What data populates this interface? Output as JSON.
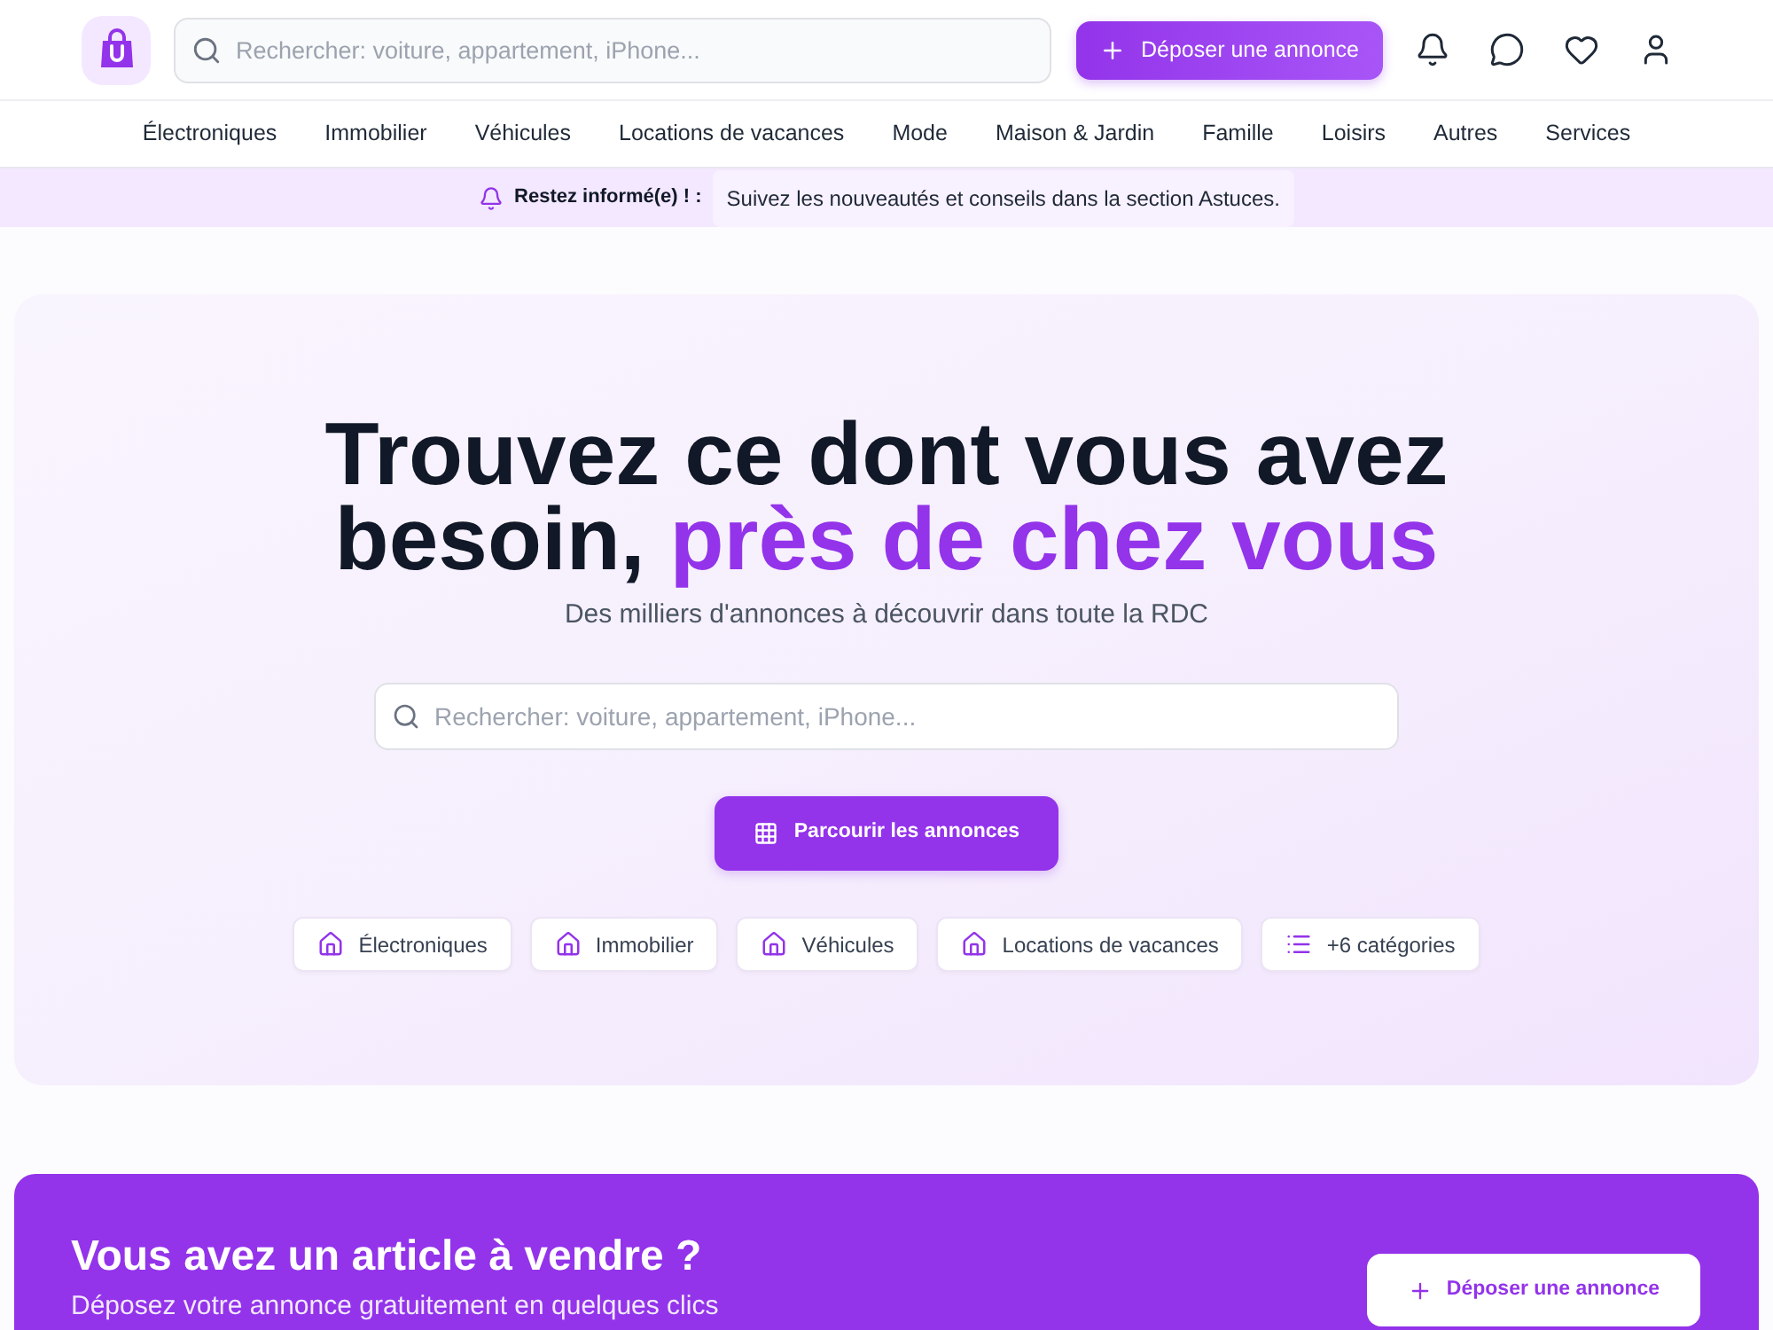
{
  "header": {
    "search": {
      "placeholder": "Rechercher: voiture, appartement, iPhone..."
    },
    "post_button": "Déposer une annonce"
  },
  "nav": [
    {
      "label": "Électroniques"
    },
    {
      "label": "Immobilier"
    },
    {
      "label": "Véhicules"
    },
    {
      "label": "Locations de vacances"
    },
    {
      "label": "Mode"
    },
    {
      "label": "Maison & Jardin"
    },
    {
      "label": "Famille"
    },
    {
      "label": "Loisirs"
    },
    {
      "label": "Autres"
    },
    {
      "label": "Services"
    }
  ],
  "info_bar": {
    "title": "Restez informé(e) ! :",
    "message": "Suivez les nouveautés et conseils dans la section Astuces."
  },
  "hero": {
    "title": "Trouvez ce dont vous avez besoin,",
    "title_highlight": "près de chez vous",
    "subtitle": "Des milliers d'annonces à découvrir dans toute la RDC",
    "search": {
      "placeholder": "Rechercher: voiture, appartement, iPhone..."
    },
    "browse_button": "Parcourir les annonces",
    "categories": [
      {
        "label": "Électroniques",
        "kind": "category"
      },
      {
        "label": "Immobilier",
        "kind": "category"
      },
      {
        "label": "Véhicules",
        "kind": "category"
      },
      {
        "label": "Locations de vacances",
        "kind": "category"
      },
      {
        "label": "+6 catégories",
        "kind": "more"
      }
    ]
  },
  "sell_banner": {
    "title": "Vous avez un article à vendre ?",
    "subtitle": "Déposez votre annonce gratuitement en quelques clics",
    "button": "Déposer une annonce"
  }
}
